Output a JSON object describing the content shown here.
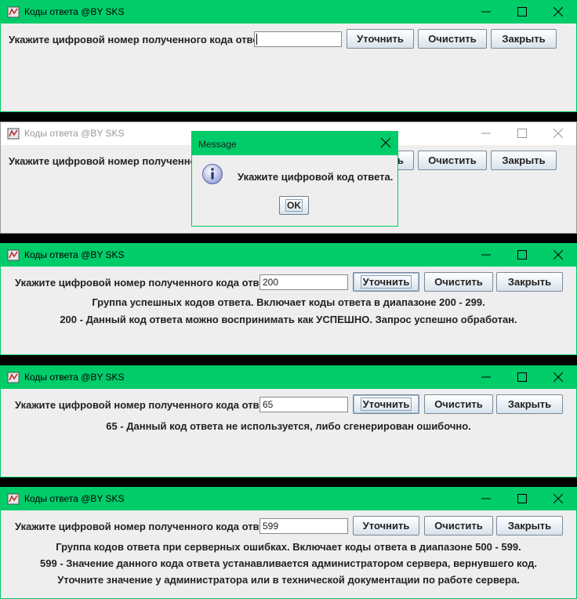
{
  "colors": {
    "titlebar_active": "#00cc6a",
    "titlebar_inactive": "#ffffff",
    "window_bg": "#eeeeee"
  },
  "prompt_label": "Укажите цифровой номер полученного кода ответа:",
  "buttons": {
    "refine": "Уточнить",
    "clear": "Очистить",
    "close": "Закрыть"
  },
  "windows": [
    {
      "title": "Коды ответа @BY SKS",
      "input_value": "",
      "messages": []
    },
    {
      "title": "Коды ответа @BY SKS",
      "input_value": "",
      "messages": []
    },
    {
      "title": "Коды ответа @BY SKS",
      "input_value": "200",
      "messages": [
        "Группа успешных кодов ответа. Включает коды ответа в диапазоне 200 - 299.",
        "200 - Данный код ответа можно воспринимать как УСПЕШНО. Запрос успешно обработан."
      ]
    },
    {
      "title": "Коды ответа @BY SKS",
      "input_value": "65",
      "messages": [
        "65 - Данный код ответа не используется, либо сгенерирован ошибочно."
      ]
    },
    {
      "title": "Коды ответа @BY SKS",
      "input_value": "599",
      "messages": [
        "Группа кодов ответа при серверных ошибках. Включает коды ответа в диапазоне 500 - 599.",
        "599 - Значение данного кода ответа устанавливается администратором сервера, вернувшего код.",
        "Уточните значение у администратора или в технической документации по работе сервера."
      ]
    }
  ],
  "dialog": {
    "title": "Message",
    "text": "Укажите цифровой код ответа.",
    "ok": "OK",
    "icon": "info-icon"
  }
}
